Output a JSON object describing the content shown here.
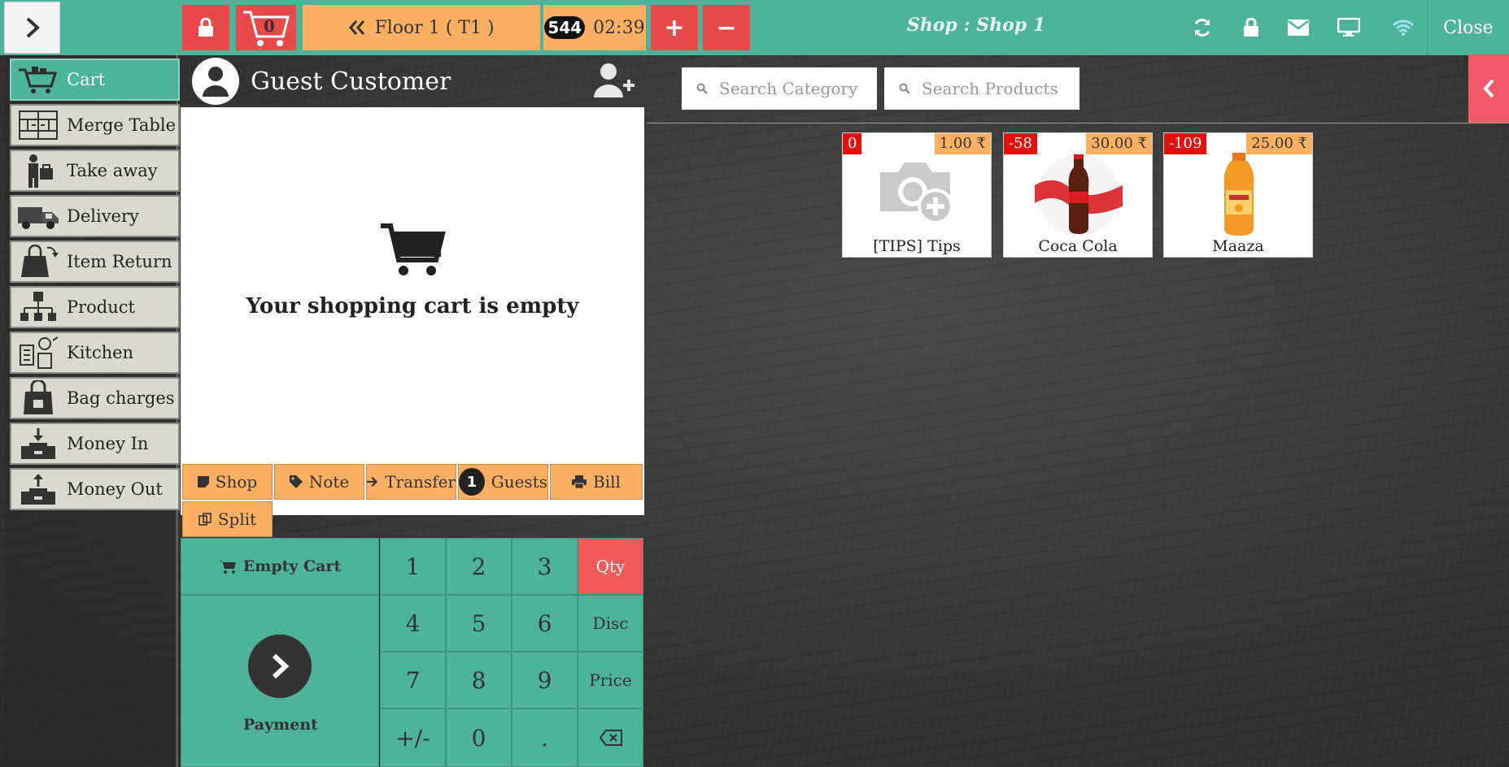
{
  "topbar": {
    "cart_count": "0",
    "floor_label": "Floor 1 ( T1 )",
    "timer_badge": "544",
    "timer_time": "02:39",
    "plus": "+",
    "minus": "−",
    "shop_title": "Shop : Shop 1",
    "close_label": "Close"
  },
  "menu": {
    "items": [
      {
        "label": "Cart",
        "icon": "cart-icon"
      },
      {
        "label": "Merge Table",
        "icon": "merge-table-icon"
      },
      {
        "label": "Take away",
        "icon": "take-away-icon"
      },
      {
        "label": "Delivery",
        "icon": "delivery-truck-icon"
      },
      {
        "label": "Item Return",
        "icon": "item-return-icon"
      },
      {
        "label": "Product",
        "icon": "product-icon"
      },
      {
        "label": "Kitchen",
        "icon": "kitchen-icon"
      },
      {
        "label": "Bag charges",
        "icon": "bag-icon"
      },
      {
        "label": "Money In",
        "icon": "money-in-icon"
      },
      {
        "label": "Money Out",
        "icon": "money-out-icon"
      }
    ]
  },
  "cart": {
    "customer_name": "Guest Customer",
    "empty_message": "Your shopping cart is empty",
    "actions": {
      "shop": "Shop",
      "note": "Note",
      "transfer": "Transfer",
      "guests_count": "1",
      "guests": "Guests",
      "bill": "Bill",
      "split": "Split"
    },
    "empty_cart_label": "Empty Cart",
    "payment_label": "Payment"
  },
  "keypad": {
    "k1": "1",
    "k2": "2",
    "k3": "3",
    "k4": "4",
    "k5": "5",
    "k6": "6",
    "k7": "7",
    "k8": "8",
    "k9": "9",
    "plusminus": "+/-",
    "k0": "0",
    "dot": ".",
    "qty": "Qty",
    "disc": "Disc",
    "price": "Price"
  },
  "search": {
    "category_placeholder": "Search Category",
    "products_placeholder": "Search Products"
  },
  "products": [
    {
      "name": "[TIPS] Tips",
      "stock": "0",
      "price": "1.00 ₹"
    },
    {
      "name": "Coca Cola",
      "stock": "-58",
      "price": "30.00 ₹"
    },
    {
      "name": "Maaza",
      "stock": "-109",
      "price": "25.00 ₹"
    }
  ],
  "colors": {
    "teal": "#4db39b",
    "orange": "#fdb062",
    "red": "#e84a4a",
    "stock_red": "#e30f0f"
  }
}
